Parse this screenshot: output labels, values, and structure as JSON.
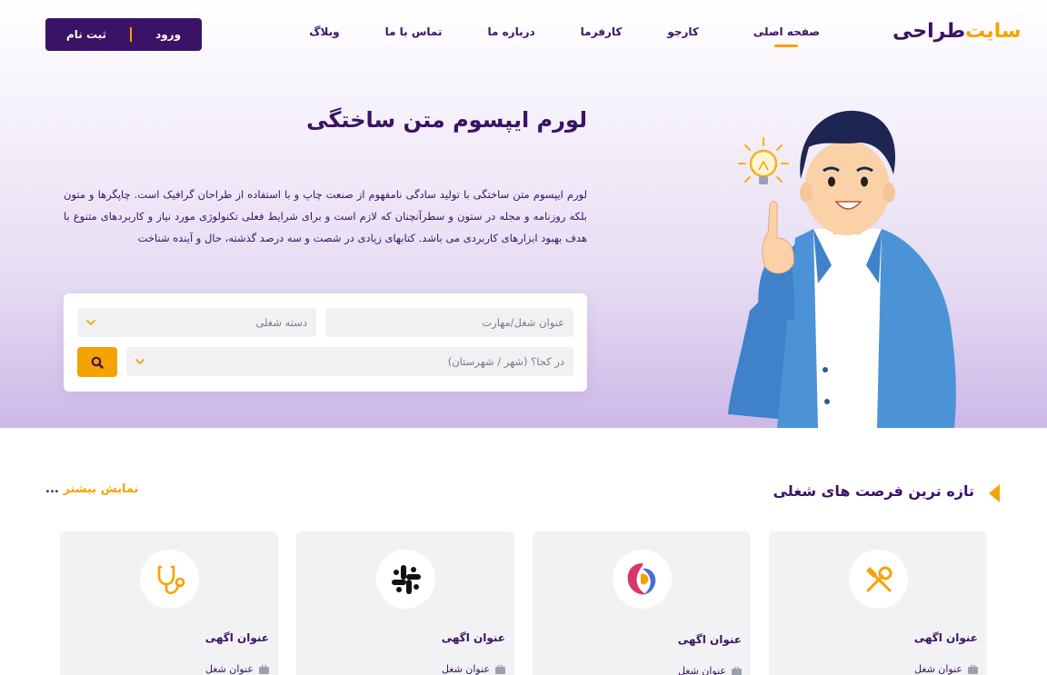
{
  "brand": {
    "logo_part1": "طراحی",
    "logo_part2": "سایت"
  },
  "nav": {
    "items": [
      "صفحه اصلی",
      "کارجو",
      "کارفرما",
      "درباره ما",
      "تماس با ما",
      "وبلاگ"
    ],
    "active_index": 0
  },
  "auth": {
    "login": "ورود",
    "register": "ثبت نام"
  },
  "hero": {
    "title": "لورم ایپسوم متن ساختگی",
    "description": "لورم ایپسوم متن ساختگی با تولید سادگی نامفهوم از صنعت چاپ و با استفاده از طراحان گرافیک است. چاپگرها و متون بلکه روزنامه و مجله در ستون و سطرآنچنان که لازم است و برای شرایط فعلی تکنولوژی مورد نیاز و کاربردهای متنوع با هدف بهبود ابزارهای کاربردی می باشد. کتابهای زیادی در شصت و سه درصد گذشته، حال و آینده شناخت"
  },
  "search": {
    "keyword_placeholder": "عنوان شغل/مهارت",
    "category_placeholder": "دسته شغلی",
    "location_placeholder": "در کجا؟ (شهر / شهرستان)"
  },
  "section": {
    "title": "تازه ترین فرصت های شغلی",
    "more_label": "نمایش بیشتر",
    "more_suffix": "..."
  },
  "cards": [
    {
      "title": "عنوان اگهی",
      "subtitle": "عنوان شغل",
      "icon": "tools-icon"
    },
    {
      "title": "عنوان اگهی",
      "subtitle": "عنوان شغل",
      "icon": "swirl-logo-icon"
    },
    {
      "title": "عنوان اگهی",
      "subtitle": "عنوان شغل",
      "icon": "slack-logo-icon"
    },
    {
      "title": "عنوان اگهی",
      "subtitle": "عنوان شغل",
      "icon": "stethoscope-icon"
    }
  ],
  "colors": {
    "primary": "#3b1366",
    "accent": "#f5a300",
    "card": "#f2f2f4"
  }
}
